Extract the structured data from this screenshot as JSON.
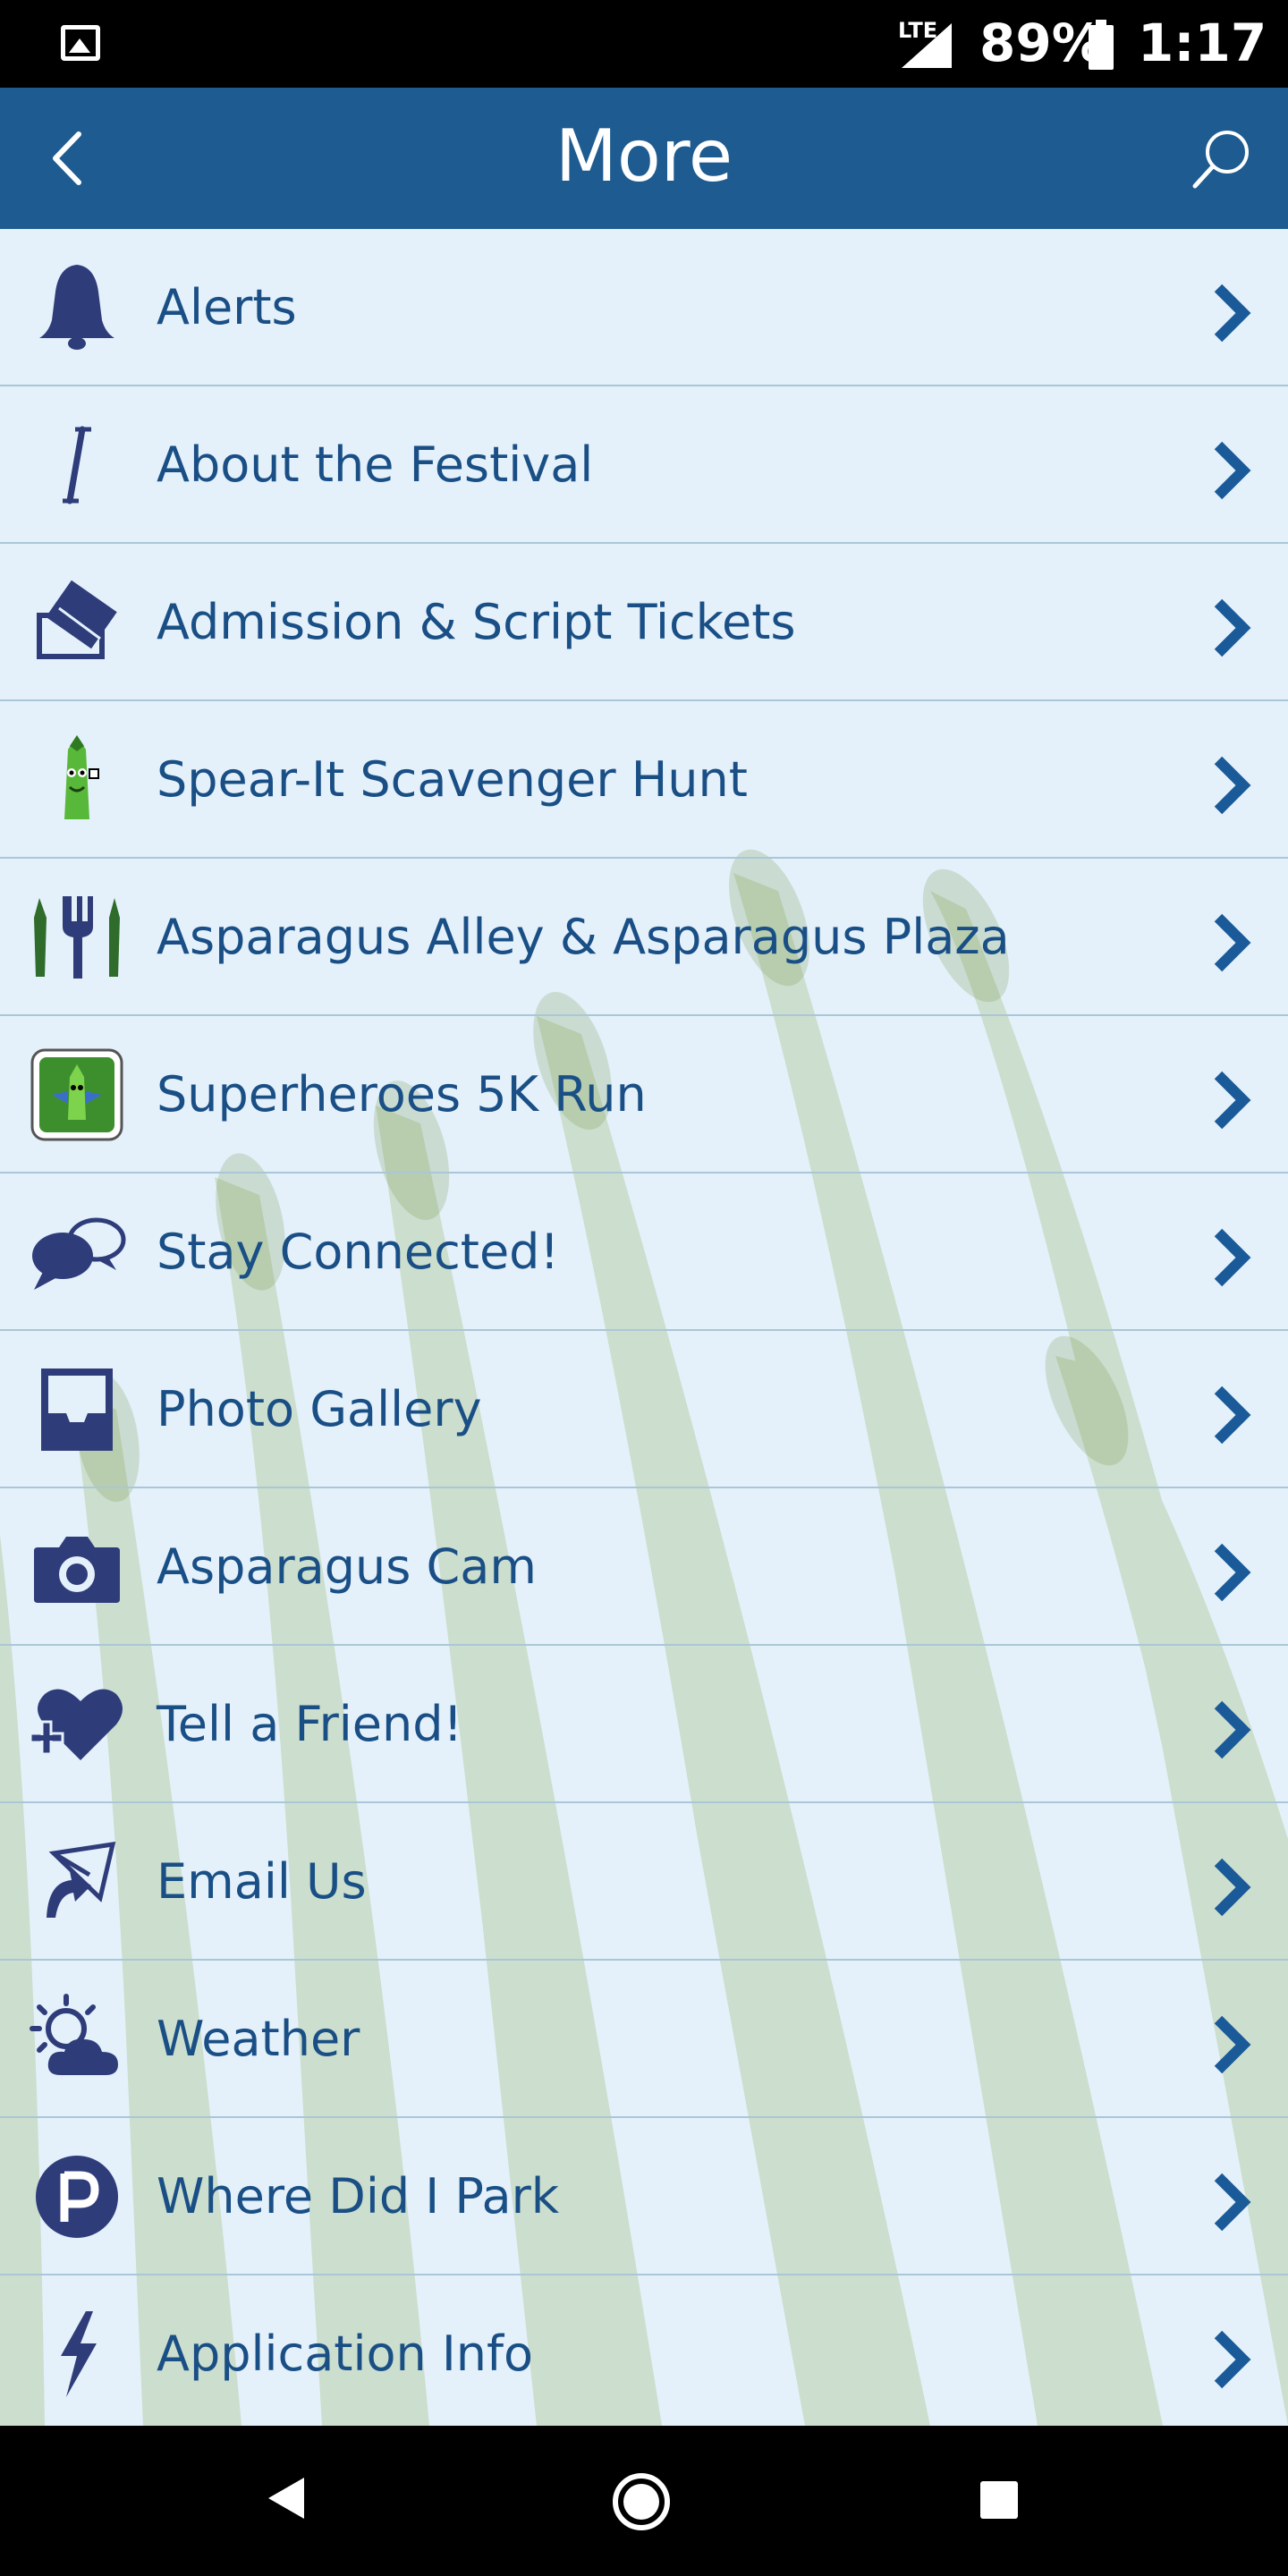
{
  "status_bar": {
    "network": "LTE",
    "battery": "89%",
    "time": "1:17"
  },
  "header": {
    "title": "More"
  },
  "menu": [
    {
      "label": "Alerts",
      "icon": "bell-icon"
    },
    {
      "label": "About the Festival",
      "icon": "info-i-icon"
    },
    {
      "label": "Admission & Script Tickets",
      "icon": "tickets-icon"
    },
    {
      "label": "Spear-It Scavenger Hunt",
      "icon": "asparagus-mascot-icon"
    },
    {
      "label": "Asparagus Alley & Asparagus Plaza",
      "icon": "fork-asparagus-icon"
    },
    {
      "label": "Superheroes 5K Run",
      "icon": "superhero-asparagus-icon"
    },
    {
      "label": "Stay Connected!",
      "icon": "chat-bubbles-icon"
    },
    {
      "label": "Photo Gallery",
      "icon": "photo-tray-icon"
    },
    {
      "label": "Asparagus Cam",
      "icon": "camera-icon"
    },
    {
      "label": "Tell a Friend!",
      "icon": "heart-plus-icon"
    },
    {
      "label": "Email Us",
      "icon": "email-arrow-icon"
    },
    {
      "label": "Weather",
      "icon": "sun-cloud-icon"
    },
    {
      "label": "Where Did I Park",
      "icon": "parking-icon"
    },
    {
      "label": "Application Info",
      "icon": "lightning-icon"
    }
  ],
  "colors": {
    "header_bg": "#1d5b91",
    "list_bg": "#e4f1fb",
    "label_text": "#1a4f86",
    "icon_navy": "#2f3c7a",
    "chevron": "#1a5a99",
    "divider": "#a9c7d6"
  }
}
